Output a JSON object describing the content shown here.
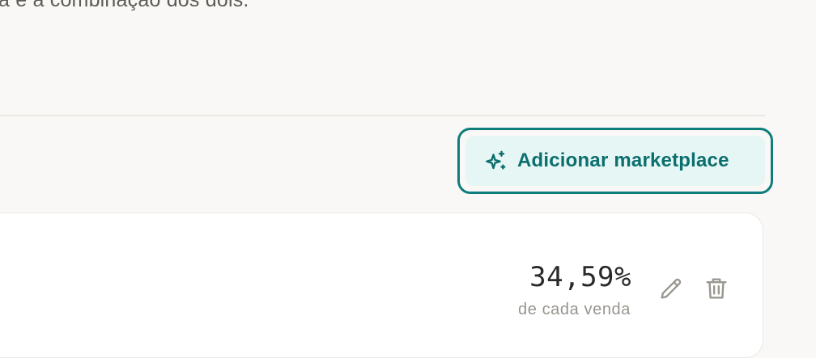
{
  "description": {
    "text": "a e a combinação dos dois."
  },
  "toolbar": {
    "add_marketplace_label": "Adicionar marketplace",
    "add_marketplace_icon": "sparkles-icon"
  },
  "marketplace_card": {
    "rate": "34,59%",
    "rate_caption": "de cada venda",
    "edit_icon": "pencil-icon",
    "delete_icon": "trash-icon"
  },
  "colors": {
    "accent": "#0e7d7b",
    "accent_text": "#0b6f6d",
    "accent_bg": "#e5f6f5",
    "page_bg": "#f9f8f6",
    "card_bg": "#ffffff",
    "muted_text": "#98958f",
    "icon_gray": "#9a9791"
  }
}
